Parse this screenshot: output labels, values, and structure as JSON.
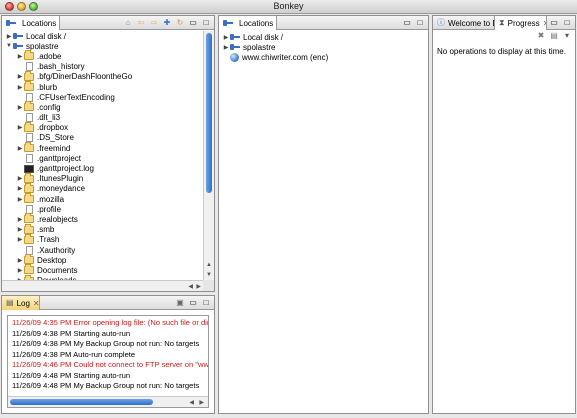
{
  "window": {
    "title": "Bonkey"
  },
  "left_pane": {
    "tab_label": "Locations",
    "tree": [
      {
        "label": "Local disk /",
        "icon": "drive-icon",
        "arrow": "right",
        "indent": 0
      },
      {
        "label": "spolastre",
        "icon": "drive-icon",
        "arrow": "down",
        "indent": 0
      },
      {
        "label": ".adobe",
        "icon": "folder-icon",
        "arrow": "right",
        "indent": 1
      },
      {
        "label": ".bash_history",
        "icon": "file-icon",
        "arrow": "",
        "indent": 1
      },
      {
        "label": ".bfg/DinerDashFloontheGo",
        "icon": "folder-icon",
        "arrow": "right",
        "indent": 1
      },
      {
        "label": ".blurb",
        "icon": "folder-icon",
        "arrow": "right",
        "indent": 1
      },
      {
        "label": ".CFUserTextEncoding",
        "icon": "file-icon",
        "arrow": "",
        "indent": 1
      },
      {
        "label": ".config",
        "icon": "folder-icon",
        "arrow": "right",
        "indent": 1
      },
      {
        "label": ".dlt_li3",
        "icon": "file-icon",
        "arrow": "",
        "indent": 1
      },
      {
        "label": ".dropbox",
        "icon": "folder-icon",
        "arrow": "right",
        "indent": 1
      },
      {
        "label": ".DS_Store",
        "icon": "file-icon",
        "arrow": "",
        "indent": 1
      },
      {
        "label": ".freemind",
        "icon": "folder-icon",
        "arrow": "right",
        "indent": 1
      },
      {
        "label": ".ganttproject",
        "icon": "file-icon",
        "arrow": "",
        "indent": 1
      },
      {
        "label": ".ganttproject.log",
        "icon": "terminal-icon",
        "arrow": "",
        "indent": 1
      },
      {
        "label": ".ItunesPlugin",
        "icon": "folder-icon",
        "arrow": "right",
        "indent": 1
      },
      {
        "label": ".moneydance",
        "icon": "folder-icon",
        "arrow": "right",
        "indent": 1
      },
      {
        "label": ".mozilla",
        "icon": "folder-icon",
        "arrow": "right",
        "indent": 1
      },
      {
        "label": ".profile",
        "icon": "file-icon",
        "arrow": "",
        "indent": 1
      },
      {
        "label": ".realobjects",
        "icon": "folder-icon",
        "arrow": "right",
        "indent": 1
      },
      {
        "label": ".smb",
        "icon": "folder-icon",
        "arrow": "right",
        "indent": 1
      },
      {
        "label": ".Trash",
        "icon": "folder-icon",
        "arrow": "right",
        "indent": 1
      },
      {
        "label": ".Xauthority",
        "icon": "file-icon",
        "arrow": "",
        "indent": 1
      },
      {
        "label": "Desktop",
        "icon": "folder-icon",
        "arrow": "right",
        "indent": 1
      },
      {
        "label": "Documents",
        "icon": "folder-icon",
        "arrow": "right",
        "indent": 1
      },
      {
        "label": "Downloads",
        "icon": "folder-icon",
        "arrow": "right",
        "indent": 1
      }
    ]
  },
  "log_pane": {
    "tab_label": "Log",
    "lines": [
      {
        "text": "11/26/09 4:35 PM Error opening log file:  (No such file or direc",
        "level": "error"
      },
      {
        "text": "11/26/09 4:38 PM Starting auto-run",
        "level": "info"
      },
      {
        "text": "11/26/09 4:38 PM My Backup Group not run: No targets",
        "level": "info"
      },
      {
        "text": "11/26/09 4:38 PM Auto-run complete",
        "level": "info"
      },
      {
        "text": "11/26/09 4:46 PM Could not connect to FTP server on \"www.ch",
        "level": "error"
      },
      {
        "text": "11/26/09 4:48 PM Starting auto-run",
        "level": "info"
      },
      {
        "text": "11/26/09 4:48 PM My Backup Group not run: No targets",
        "level": "info"
      }
    ]
  },
  "middle_pane": {
    "tab_label": "Locations",
    "tree": [
      {
        "label": "Local disk /",
        "icon": "drive-icon",
        "arrow": "right"
      },
      {
        "label": "spolastre",
        "icon": "drive-icon",
        "arrow": "right"
      },
      {
        "label": "www.chiwriter.com (enc)",
        "icon": "globe-icon",
        "arrow": ""
      }
    ]
  },
  "right_pane": {
    "tabs": [
      {
        "label": "Welcome to B...",
        "icon": "info-icon"
      },
      {
        "label": "Progress",
        "icon": "progress-icon"
      }
    ],
    "message": "No operations to display at this time."
  },
  "colors": {
    "error_text": "#d11a1a",
    "scroll_thumb": "#2f6fc7",
    "log_tab": "#f6d37b"
  }
}
